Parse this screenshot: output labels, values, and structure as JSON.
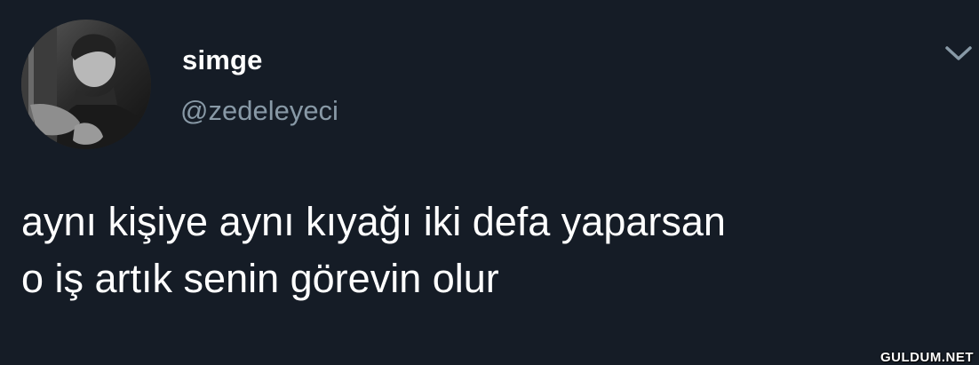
{
  "tweet": {
    "display_name": "simge",
    "handle": "@zedeleyeci",
    "text_lines": [
      "aynı kişiye aynı kıyağı iki defa yaparsan",
      "o iş artık senin görevin olur"
    ]
  },
  "icons": {
    "avatar": "profile-photo",
    "menu": "chevron-down-icon"
  },
  "colors": {
    "background": "#151c26",
    "text_primary": "#ffffff",
    "text_secondary": "#8899a6"
  },
  "watermark": "GULDUM.NET"
}
